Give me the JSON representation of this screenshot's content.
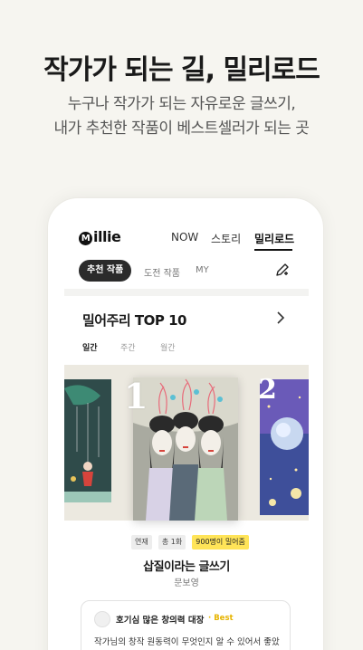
{
  "promo": {
    "headline": "작가가 되는 길, 밀리로드",
    "subline_1": "누구나 작가가 되는 자유로운 글쓰기,",
    "subline_2": "내가 추천한 작품이 베스트셀러가 되는 곳"
  },
  "app": {
    "logo_text": "illie",
    "logo_mark": "M",
    "nav": {
      "now": "NOW",
      "story": "스토리",
      "millie_road": "밀리로드"
    },
    "subtabs": {
      "recommended": "추천 작품",
      "challenge": "도전 작품",
      "my": "MY"
    }
  },
  "ranking": {
    "title": "밀어주리 TOP 10",
    "periods": {
      "daily": "일간",
      "weekly": "주간",
      "monthly": "월간"
    },
    "rank_first": "1",
    "rank_second": "2"
  },
  "book": {
    "badge_serial": "연재",
    "badge_episodes": "총 1화",
    "badge_pushes": "900명이 밀어줌",
    "title": "삽질이라는 글쓰기",
    "author": "문보영"
  },
  "review": {
    "author": "호기심 많은 창의력 대장",
    "best_label": "Best",
    "text": "작가님의 창작 원동력이 무엇인지 알 수 있어서 좋았습니다!!"
  },
  "colors": {
    "accent": "#ffe458",
    "background": "#f6f5f0",
    "dark": "#2b2b2b"
  }
}
